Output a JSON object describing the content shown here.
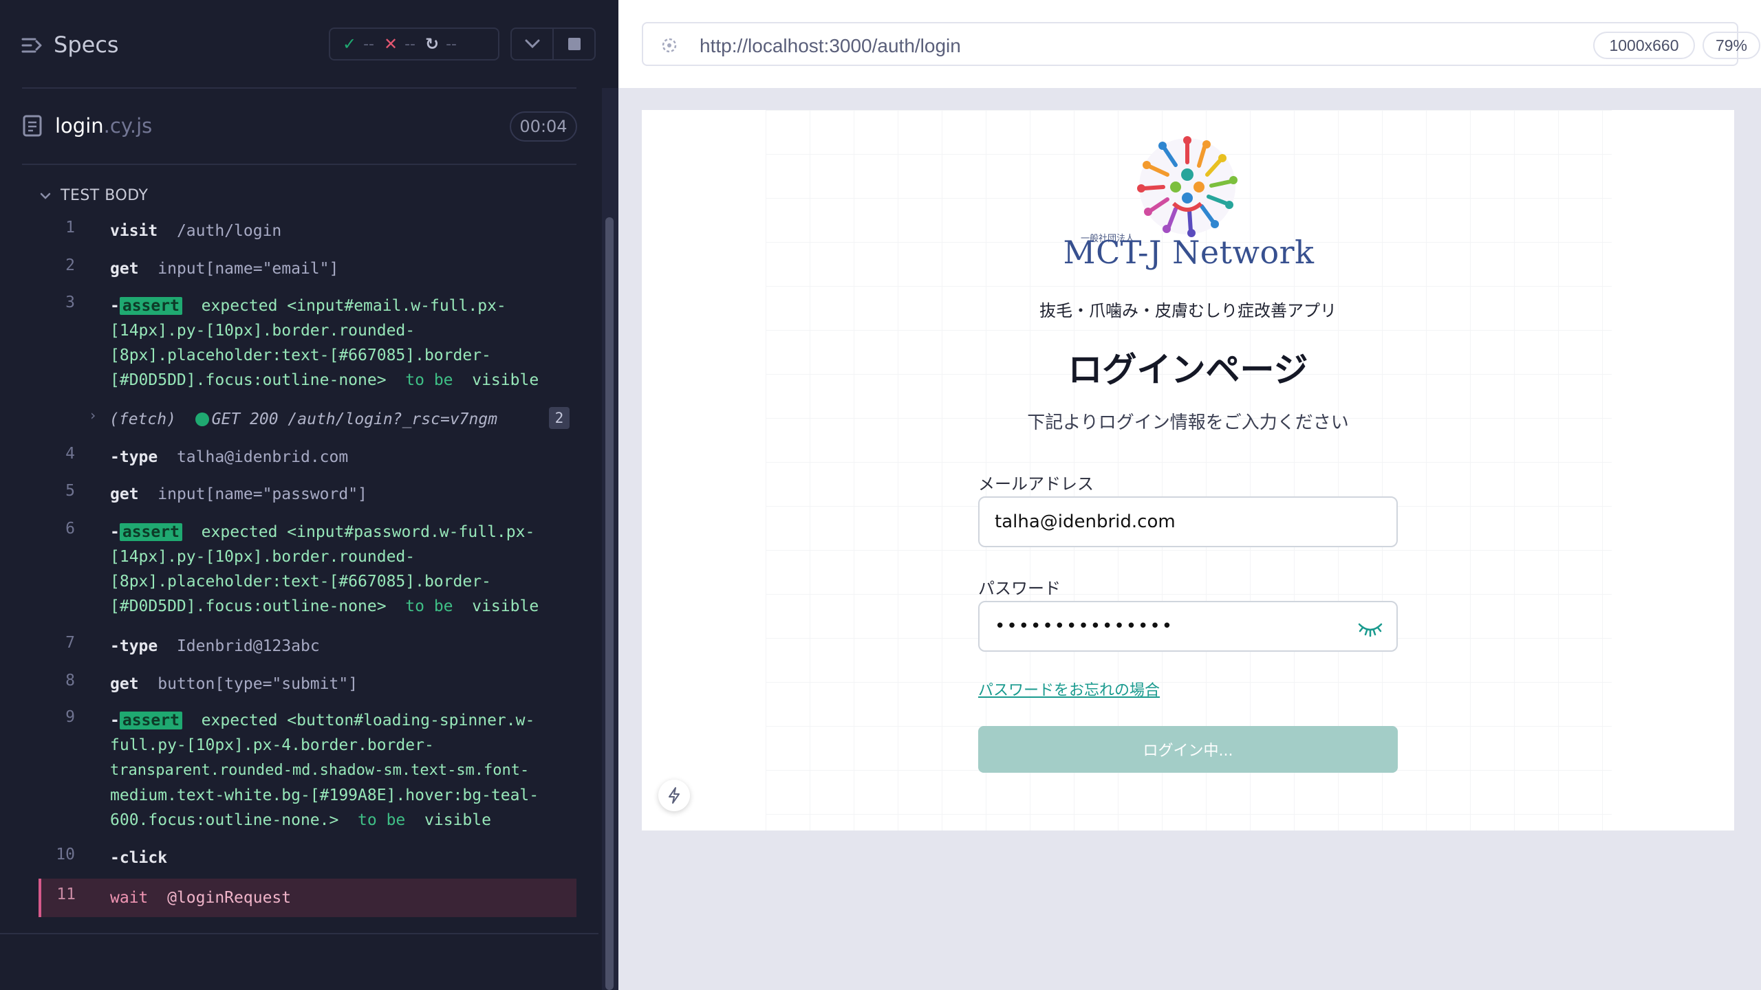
{
  "reporter": {
    "title": "Specs",
    "stats": {
      "passed": "--",
      "failed": "--",
      "pending": "--"
    },
    "spec": {
      "name": "login",
      "ext": ".cy.js",
      "duration": "00:04"
    },
    "section_header": "TEST BODY",
    "commands": [
      {
        "num": "1",
        "name": "visit",
        "arg": "/auth/login"
      },
      {
        "num": "2",
        "name": "get",
        "arg": "input[name=\"email\"]"
      },
      {
        "num": "3",
        "dash": "-",
        "badge": "assert",
        "lines": [
          "expected <input#email.w-full.px-",
          "[14px].py-[10px].border.rounded-",
          "[8px].placeholder:text-[#667085].border-",
          "[#D0D5DD].focus:outline-none>"
        ],
        "to_be": "to be",
        "visible": "visible"
      },
      {
        "fetch": "(fetch)",
        "request": "GET 200 /auth/login?_rsc=v7ngm",
        "count": "2"
      },
      {
        "num": "4",
        "dash": "-",
        "name": "type",
        "arg": "talha@idenbrid.com"
      },
      {
        "num": "5",
        "name": "get",
        "arg": "input[name=\"password\"]"
      },
      {
        "num": "6",
        "dash": "-",
        "badge": "assert",
        "lines": [
          "expected <input#password.w-full.px-",
          "[14px].py-[10px].border.rounded-",
          "[8px].placeholder:text-[#667085].border-",
          "[#D0D5DD].focus:outline-none>"
        ],
        "to_be": "to be",
        "visible": "visible"
      },
      {
        "num": "7",
        "dash": "-",
        "name": "type",
        "arg": "Idenbrid@123abc"
      },
      {
        "num": "8",
        "name": "get",
        "arg": "button[type=\"submit\"]"
      },
      {
        "num": "9",
        "dash": "-",
        "badge": "assert",
        "lines": [
          "expected <button#loading-spinner.w-",
          "full.py-[10px].px-4.border.border-",
          "transparent.rounded-md.shadow-sm.text-sm.font-",
          "medium.text-white.bg-[#199A8E].hover:bg-teal-",
          "600.focus:outline-none.>"
        ],
        "to_be": "to be",
        "visible": "visible"
      },
      {
        "num": "10",
        "dash": "-",
        "name": "click",
        "arg": ""
      },
      {
        "num": "11",
        "name": "wait",
        "arg": "@loginRequest"
      }
    ]
  },
  "aut": {
    "url": "http://localhost:3000/auth/login",
    "viewport": "1000x660",
    "scale": "79%"
  },
  "app": {
    "logo_small": "一般社団法人",
    "logo_text": "MCT-J Network",
    "subtitle": "抜毛・爪噛み・皮膚むしり症改善アプリ",
    "title": "ログインページ",
    "description": "下記よりログイン情報をご入力ください",
    "email_label": "メールアドレス",
    "email_value": "talha@idenbrid.com",
    "password_label": "パスワード",
    "password_value": "•••••••••••••••",
    "forgot_link": "パスワードをお忘れの場合",
    "login_button": "ログイン中..."
  },
  "colors": {
    "reporter_bg": "#1b1e2e",
    "assert_green": "#1fa971",
    "teal": "#199A8E",
    "button_disabled": "#a3cdc7",
    "logo_blue": "#37508f"
  }
}
